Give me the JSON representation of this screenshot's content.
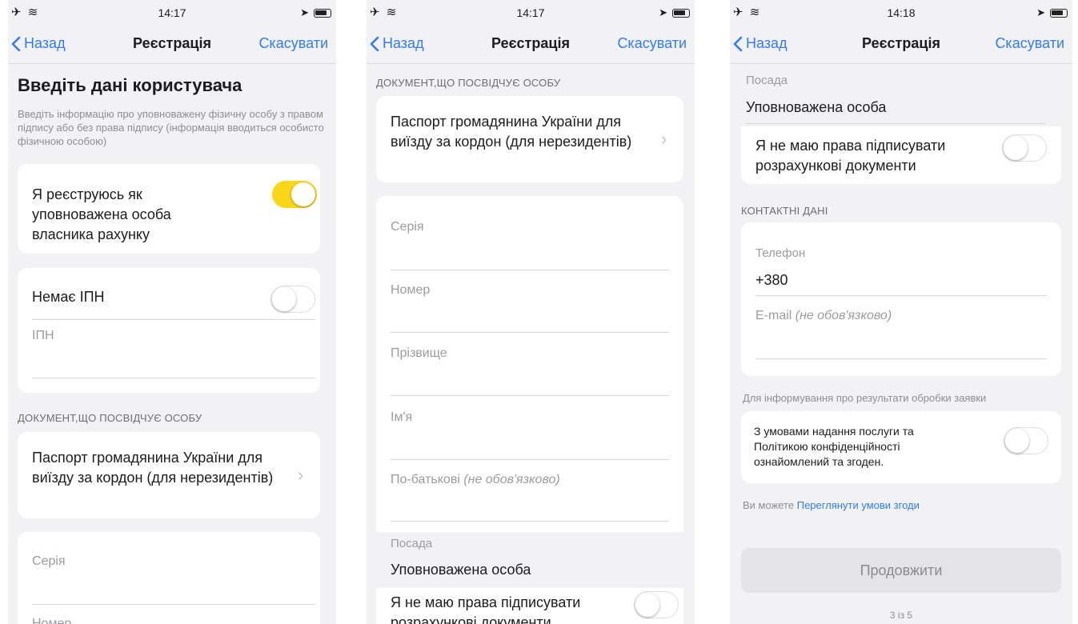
{
  "status": {
    "time1": "14:17",
    "time2": "14:17",
    "time3": "14:18",
    "left_icons": "✈ ≋",
    "arrow": "➤"
  },
  "nav": {
    "back": "Назад",
    "title": "Реєстрація",
    "cancel": "Скасувати"
  },
  "screen1": {
    "heading": "Введіть дані користувача",
    "description": "Введіть інформацію про уповноважену фізичну особу з правом підпису або без права підпису (інформація вводиться особисто фізичною особою)",
    "authorized_label": "Я реєструюсь як уповноважена особа власника рахунку",
    "authorized_on": true,
    "no_ipn_label": "Немає ІПН",
    "ipn_placeholder": "ІПН",
    "doc_section": "ДОКУМЕНТ,ЩО ПОСВІДЧУЄ ОСОБУ",
    "doc_value": "Паспорт громадянина України для виїзду за кордон (для нерезидентів)",
    "series_placeholder": "Серія",
    "number_placeholder": "Номер"
  },
  "screen2": {
    "doc_section": "ДОКУМЕНТ,ЩО ПОСВІДЧУЄ ОСОБУ",
    "doc_value": "Паспорт громадянина України для виїзду за кордон (для нерезидентів)",
    "series_placeholder": "Серія",
    "number_placeholder": "Номер",
    "surname_placeholder": "Прізвище",
    "name_placeholder": "Ім'я",
    "patronymic_placeholder": "По-батькові",
    "optional": "(не обов'язково)",
    "position_label": "Посада",
    "position_value": "Уповноважена особа",
    "no_sign_label": "Я не маю права підписувати розрахункові документи"
  },
  "screen3": {
    "position_label": "Посада",
    "position_value": "Уповноважена особа",
    "no_sign_label": "Я не маю права підписувати розрахункові документи",
    "contacts_section": "КОНТАКТНІ ДАНІ",
    "phone_label": "Телефон",
    "phone_value": "+380",
    "email_placeholder": "E-mail",
    "optional": "(не обов'язково)",
    "info_note": "Для інформування про результати обробки заявки",
    "consent_label": "З умовами надання послуги та Політикою конфіденційності ознайомлений та згоден.",
    "terms_prefix": "Ви можете",
    "terms_link": "Переглянути умови згоди",
    "continue_button": "Продовжити",
    "step": "3 із 5"
  }
}
